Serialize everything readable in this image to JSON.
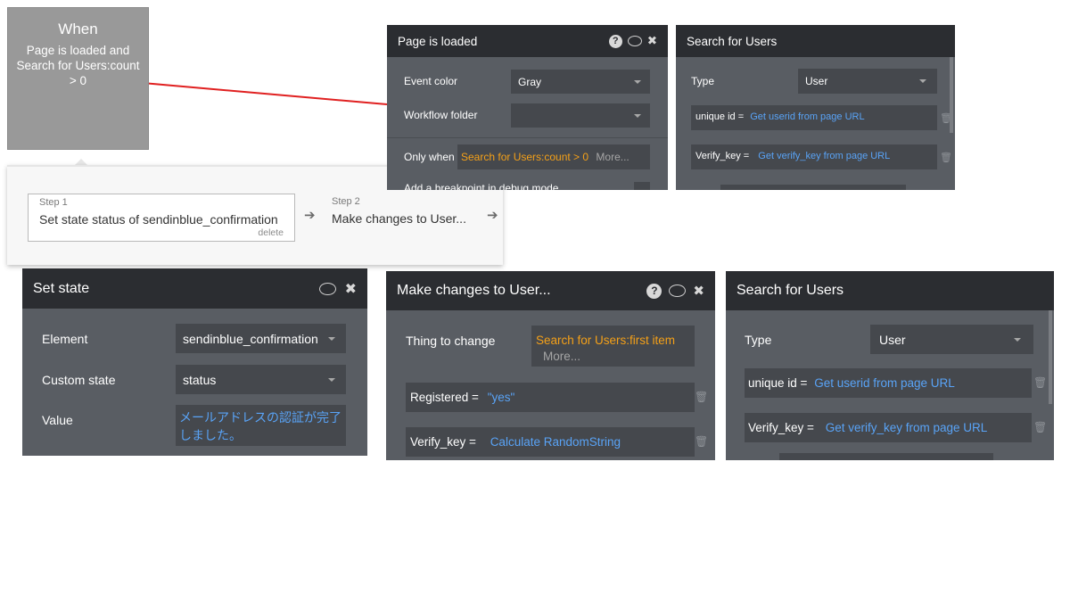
{
  "trigger": {
    "title": "When",
    "condition": "Page is loaded and Search for Users:count > 0"
  },
  "steps": [
    {
      "label": "Step 1",
      "name": "Set state status of sendinblue_confirmation",
      "delete": "delete"
    },
    {
      "label": "Step 2",
      "name": "Make changes to User..."
    }
  ],
  "event_panel": {
    "title": "Page is loaded",
    "event_color_label": "Event color",
    "event_color_value": "Gray",
    "workflow_folder_label": "Workflow folder",
    "workflow_folder_value": "",
    "only_when_label": "Only when",
    "only_when_value": "Search for Users:count > 0",
    "only_when_more": "More...",
    "breakpoint_label": "Add a breakpoint in debug mode"
  },
  "search_small": {
    "title": "Search for Users",
    "type_label": "Type",
    "type_value": "User",
    "c1_key": "unique id =",
    "c1_value": "Get userid from page URL",
    "c2_key": "Verify_key =",
    "c2_value": "Get verify_key from page URL"
  },
  "setstate_panel": {
    "title": "Set state",
    "element_label": "Element",
    "element_value": "sendinblue_confirmation",
    "custom_state_label": "Custom state",
    "custom_state_value": "status",
    "value_label": "Value",
    "value_line1": "メールアドレスの認証が完了",
    "value_line2": "しました。"
  },
  "makechanges_panel": {
    "title": "Make changes to User...",
    "thing_label": "Thing to change",
    "thing_value": "Search for Users:first item",
    "thing_more": "More...",
    "f1_key": "Registered =",
    "f1_value": "\"yes\"",
    "f2_key": "Verify_key =",
    "f2_value": "Calculate RandomString"
  },
  "search_large": {
    "title": "Search for Users",
    "type_label": "Type",
    "type_value": "User",
    "c1_key": "unique id =",
    "c1_value": "Get userid from page URL",
    "c2_key": "Verify_key =",
    "c2_value": "Get verify_key from page URL"
  },
  "colors": {
    "panel_header": "#2b2d31",
    "panel_body": "#595d63",
    "field": "#45484d",
    "dynamic_orange": "#f4a018",
    "dynamic_blue": "#59a3f6",
    "connector": "#e02020"
  }
}
